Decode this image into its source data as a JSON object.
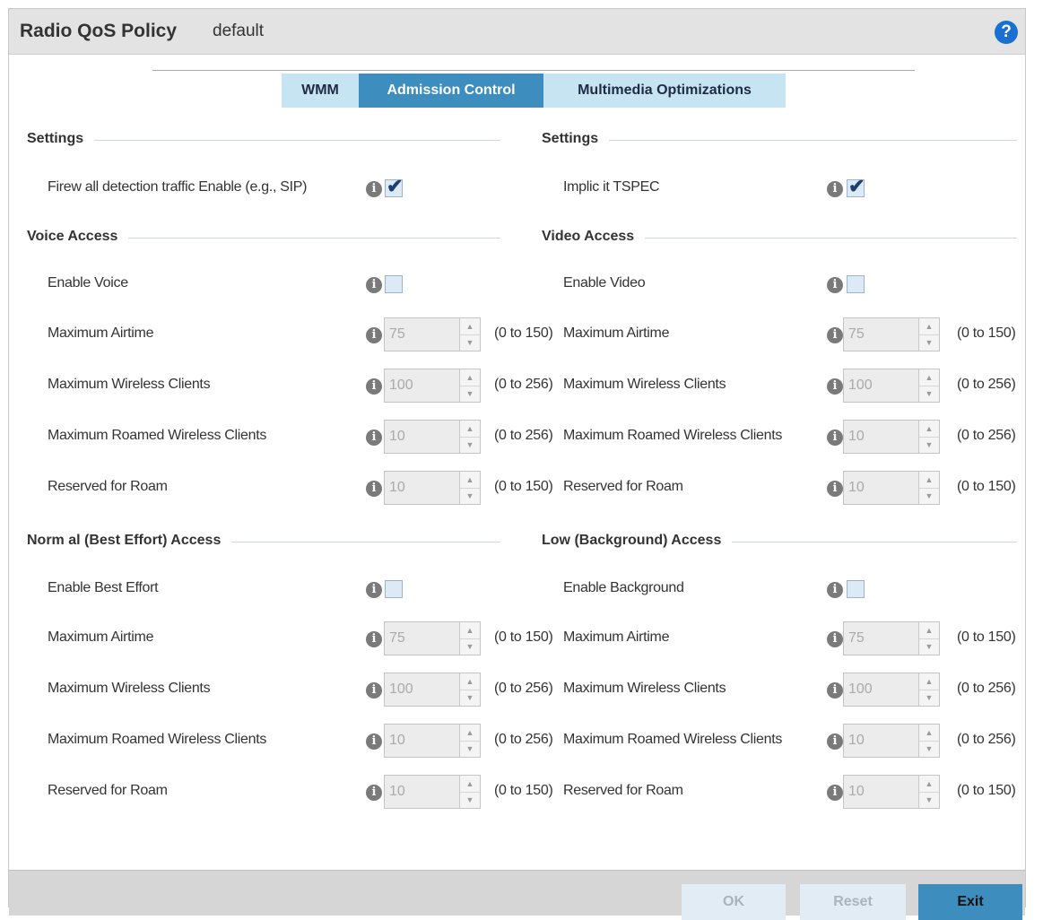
{
  "header": {
    "title": "Radio QoS Policy",
    "subtitle": "default",
    "help_glyph": "?"
  },
  "tabs": [
    {
      "label": "WMM",
      "active": false
    },
    {
      "label": "Admission Control",
      "active": true
    },
    {
      "label": "Multimedia Optimizations",
      "active": false
    }
  ],
  "left": {
    "settings_title": "Settings",
    "firewall_label": "Firew all detection traffic Enable (e.g., SIP)",
    "firewall_checked": true,
    "voice": {
      "title": "Voice Access",
      "enable_label": "Enable Voice",
      "fields": [
        {
          "label": "Maximum Airtime",
          "value": "75",
          "range": "(0 to 150)"
        },
        {
          "label": "Maximum Wireless Clients",
          "value": "100",
          "range": "(0 to 256)"
        },
        {
          "label": "Maximum Roamed Wireless Clients",
          "value": "10",
          "range": "(0 to 256)"
        },
        {
          "label": "Reserved for Roam",
          "value": "10",
          "range": "(0 to 150)"
        }
      ]
    },
    "best_effort": {
      "title": "Norm al (Best Effort) Access",
      "enable_label": "Enable Best Effort",
      "fields": [
        {
          "label": "Maximum Airtime",
          "value": "75",
          "range": "(0 to 150)"
        },
        {
          "label": "Maximum Wireless Clients",
          "value": "100",
          "range": "(0 to 256)"
        },
        {
          "label": "Maximum Roamed Wireless Clients",
          "value": "10",
          "range": "(0 to 256)"
        },
        {
          "label": "Reserved for Roam",
          "value": "10",
          "range": "(0 to 150)"
        }
      ]
    }
  },
  "right": {
    "settings_title": "Settings",
    "tspec_label": "Implic it TSPEC",
    "tspec_checked": true,
    "video": {
      "title": "Video Access",
      "enable_label": "Enable Video",
      "fields": [
        {
          "label": "Maximum Airtime",
          "value": "75",
          "range": "(0 to 150)"
        },
        {
          "label": "Maximum Wireless Clients",
          "value": "100",
          "range": "(0 to 256)"
        },
        {
          "label": "Maximum Roamed Wireless Clients",
          "value": "10",
          "range": "(0 to 256)"
        },
        {
          "label": "Reserved for Roam",
          "value": "10",
          "range": "(0 to 150)"
        }
      ]
    },
    "background": {
      "title": "Low (Background) Access",
      "enable_label": "Enable Background",
      "fields": [
        {
          "label": "Maximum Airtime",
          "value": "75",
          "range": "(0 to 150)"
        },
        {
          "label": "Maximum Wireless Clients",
          "value": "100",
          "range": "(0 to 256)"
        },
        {
          "label": "Maximum Roamed Wireless Clients",
          "value": "10",
          "range": "(0 to 256)"
        },
        {
          "label": "Reserved for Roam",
          "value": "10",
          "range": "(0 to 150)"
        }
      ]
    }
  },
  "icons": {
    "info": "info-icon",
    "spin_up": "▲",
    "spin_down": "▼",
    "check": "✔"
  },
  "footer": {
    "ok": "OK",
    "reset": "Reset",
    "exit": "Exit"
  }
}
